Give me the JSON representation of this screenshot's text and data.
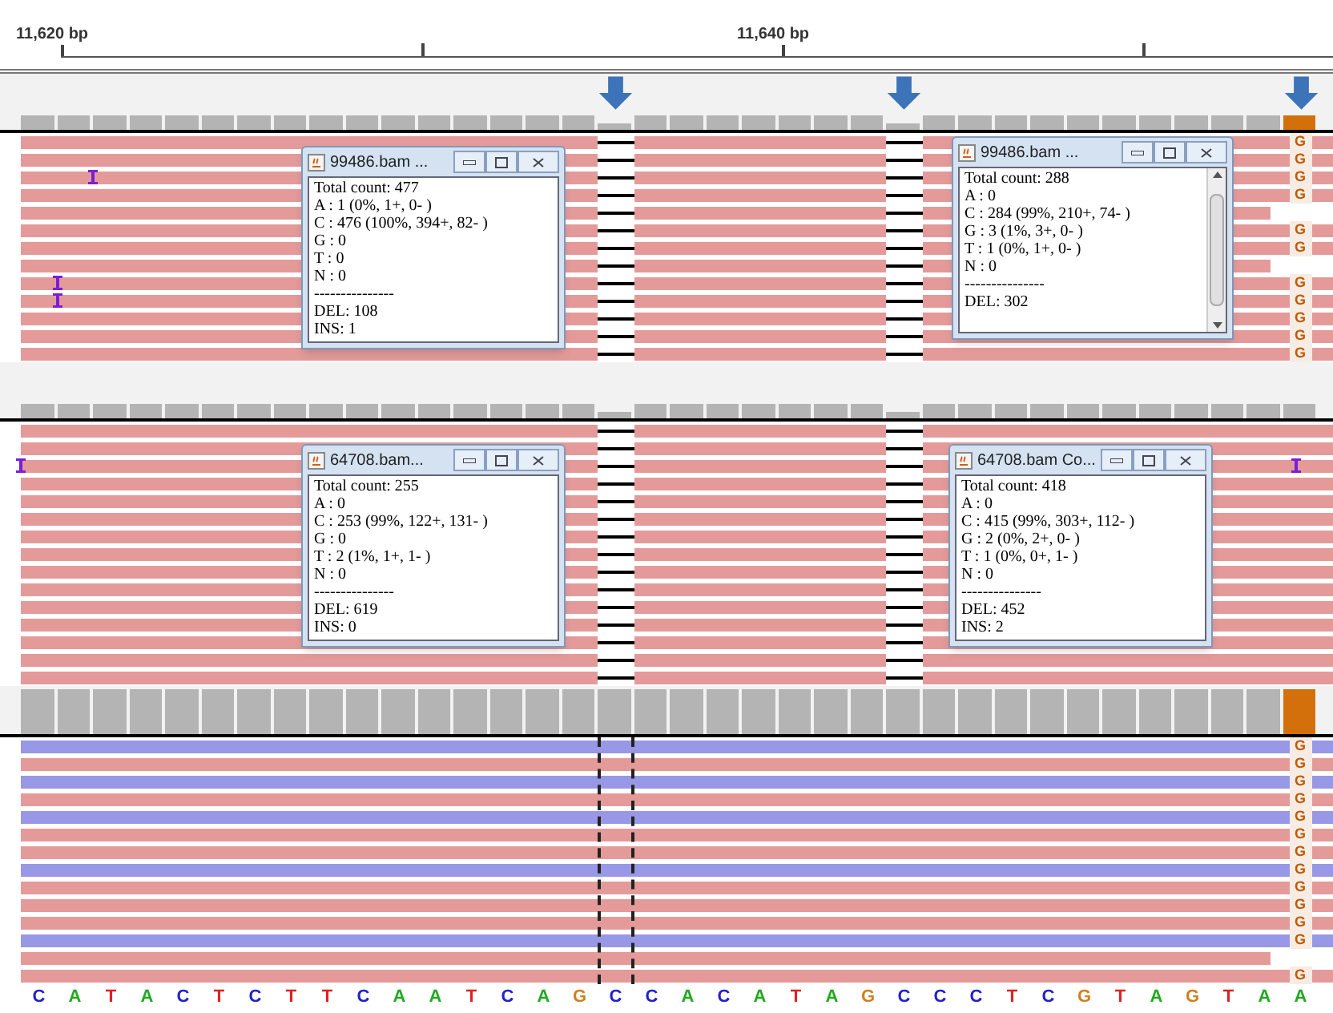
{
  "ruler": {
    "ticks": [
      "11,620 bp",
      "11,640 bp"
    ]
  },
  "panels": [
    {
      "kind": "gapped",
      "coverage": {
        "mismatch": true
      },
      "rows": [
        {
          "kind": "reverse",
          "mismatch": "G",
          "truncated": false,
          "insertion": false
        },
        {
          "kind": "reverse",
          "mismatch": "G",
          "truncated": false,
          "insertion": false
        },
        {
          "kind": "reverse",
          "mismatch": "G",
          "truncated": false,
          "insertion": true
        },
        {
          "kind": "reverse",
          "mismatch": "G",
          "truncated": false,
          "insertion": false
        },
        {
          "kind": "reverse",
          "truncated": true,
          "insertion": false
        },
        {
          "kind": "reverse",
          "mismatch": "G",
          "truncated": false,
          "insertion": false
        },
        {
          "kind": "reverse",
          "mismatch": "G",
          "truncated": false,
          "insertion": false
        },
        {
          "kind": "reverse",
          "truncated": true,
          "insertion": false
        },
        {
          "kind": "reverse",
          "mismatch": "G",
          "truncated": false,
          "insertion": true
        },
        {
          "kind": "reverse",
          "mismatch": "G",
          "truncated": false,
          "insertion": true
        },
        {
          "kind": "reverse",
          "mismatch": "G",
          "truncated": false,
          "insertion": false
        },
        {
          "kind": "reverse",
          "mismatch": "G",
          "truncated": false,
          "insertion": false
        },
        {
          "kind": "reverse",
          "mismatch": "G",
          "truncated": false,
          "insertion": false
        }
      ],
      "popups": [
        {
          "title": "99486.bam ...",
          "scrollbar": false,
          "lines": [
            "Total count: 477",
            "A : 1 (0%, 1+, 0- )",
            "C : 476 (100%, 394+, 82- )",
            "G : 0",
            "T : 0",
            "N : 0",
            "---------------",
            "DEL: 108",
            "INS: 1"
          ]
        },
        {
          "title": "99486.bam ...",
          "scrollbar": true,
          "lines": [
            "Total count: 288",
            "A : 0",
            "C : 284 (99%, 210+, 74- )",
            "G : 3 (1%, 3+, 0- )",
            "T : 1 (0%, 1+, 0- )",
            "N : 0",
            "---------------",
            "DEL: 302"
          ]
        }
      ]
    },
    {
      "kind": "gapped",
      "coverage": {
        "mismatch": false
      },
      "rows": [
        {
          "kind": "reverse",
          "truncated": false,
          "insertion": false
        },
        {
          "kind": "reverse",
          "truncated": false,
          "insertion": false
        },
        {
          "kind": "reverse",
          "truncated": false,
          "insertion": true
        },
        {
          "kind": "reverse",
          "truncated": false,
          "insertion": false
        },
        {
          "kind": "reverse",
          "truncated": false,
          "insertion": false
        },
        {
          "kind": "reverse",
          "truncated": false,
          "insertion": false
        },
        {
          "kind": "reverse",
          "truncated": false,
          "insertion": false
        },
        {
          "kind": "reverse",
          "truncated": false,
          "insertion": false
        },
        {
          "kind": "reverse",
          "truncated": false,
          "insertion": false
        },
        {
          "kind": "reverse",
          "truncated": false,
          "insertion": false
        },
        {
          "kind": "reverse",
          "truncated": false,
          "insertion": false
        },
        {
          "kind": "reverse",
          "truncated": false,
          "insertion": false
        },
        {
          "kind": "reverse",
          "truncated": false,
          "insertion": false
        },
        {
          "kind": "reverse",
          "truncated": false,
          "insertion": false
        },
        {
          "kind": "reverse",
          "truncated": false,
          "insertion": false
        }
      ],
      "popups": [
        {
          "title": "64708.bam...",
          "scrollbar": false,
          "lines": [
            "Total count: 255",
            "A : 0",
            "C : 253 (99%, 122+, 131- )",
            "G : 0",
            "T : 2 (1%, 1+, 1- )",
            "N : 0",
            "---------------",
            "DEL: 619",
            "INS: 0"
          ]
        },
        {
          "title": "64708.bam Co...",
          "scrollbar": false,
          "lines": [
            "Total count: 418",
            "A : 0",
            "C : 415 (99%, 303+, 112- )",
            "G : 2 (0%, 2+, 0- )",
            "T : 1 (0%, 0+, 1- )",
            "N : 0",
            "---------------",
            "DEL: 452",
            "INS: 2"
          ]
        }
      ]
    },
    {
      "kind": "dashed",
      "coverage": {
        "mismatch": true
      },
      "rows": [
        {
          "kind": "forward",
          "mismatch": "G",
          "truncated": false
        },
        {
          "kind": "reverse",
          "mismatch": "G",
          "truncated": false
        },
        {
          "kind": "forward",
          "mismatch": "G",
          "truncated": false
        },
        {
          "kind": "reverse",
          "mismatch": "G",
          "truncated": false
        },
        {
          "kind": "forward",
          "mismatch": "G",
          "truncated": false
        },
        {
          "kind": "reverse",
          "mismatch": "G",
          "truncated": false
        },
        {
          "kind": "reverse",
          "mismatch": "G",
          "truncated": false
        },
        {
          "kind": "forward",
          "mismatch": "G",
          "truncated": false
        },
        {
          "kind": "reverse",
          "mismatch": "G",
          "truncated": false
        },
        {
          "kind": "reverse",
          "mismatch": "G",
          "truncated": false
        },
        {
          "kind": "reverse",
          "mismatch": "G",
          "truncated": false
        },
        {
          "kind": "forward",
          "mismatch": "G",
          "truncated": false
        },
        {
          "kind": "reverse",
          "truncated": true
        },
        {
          "kind": "reverse",
          "mismatch": "G",
          "truncated": false
        }
      ]
    }
  ],
  "sequence": [
    {
      "base": "C",
      "color": "#2222cc"
    },
    {
      "base": "A",
      "color": "#22aa22"
    },
    {
      "base": "T",
      "color": "#dd2222"
    },
    {
      "base": "A",
      "color": "#22aa22"
    },
    {
      "base": "C",
      "color": "#2222cc"
    },
    {
      "base": "T",
      "color": "#dd2222"
    },
    {
      "base": "C",
      "color": "#2222cc"
    },
    {
      "base": "T",
      "color": "#dd2222"
    },
    {
      "base": "T",
      "color": "#dd2222"
    },
    {
      "base": "C",
      "color": "#2222cc"
    },
    {
      "base": "A",
      "color": "#22aa22"
    },
    {
      "base": "A",
      "color": "#22aa22"
    },
    {
      "base": "T",
      "color": "#dd2222"
    },
    {
      "base": "C",
      "color": "#2222cc"
    },
    {
      "base": "A",
      "color": "#22aa22"
    },
    {
      "base": "G",
      "color": "#d08020"
    },
    {
      "base": "C",
      "color": "#2222cc"
    },
    {
      "base": "C",
      "color": "#2222cc"
    },
    {
      "base": "A",
      "color": "#22aa22"
    },
    {
      "base": "C",
      "color": "#2222cc"
    },
    {
      "base": "A",
      "color": "#22aa22"
    },
    {
      "base": "T",
      "color": "#dd2222"
    },
    {
      "base": "A",
      "color": "#22aa22"
    },
    {
      "base": "G",
      "color": "#d08020"
    },
    {
      "base": "C",
      "color": "#2222cc"
    },
    {
      "base": "C",
      "color": "#2222cc"
    },
    {
      "base": "C",
      "color": "#2222cc"
    },
    {
      "base": "T",
      "color": "#dd2222"
    },
    {
      "base": "C",
      "color": "#2222cc"
    },
    {
      "base": "G",
      "color": "#d08020"
    },
    {
      "base": "T",
      "color": "#dd2222"
    },
    {
      "base": "A",
      "color": "#22aa22"
    },
    {
      "base": "G",
      "color": "#d08020"
    },
    {
      "base": "T",
      "color": "#dd2222"
    },
    {
      "base": "A",
      "color": "#22aa22"
    },
    {
      "base": "A",
      "color": "#22aa22"
    }
  ]
}
